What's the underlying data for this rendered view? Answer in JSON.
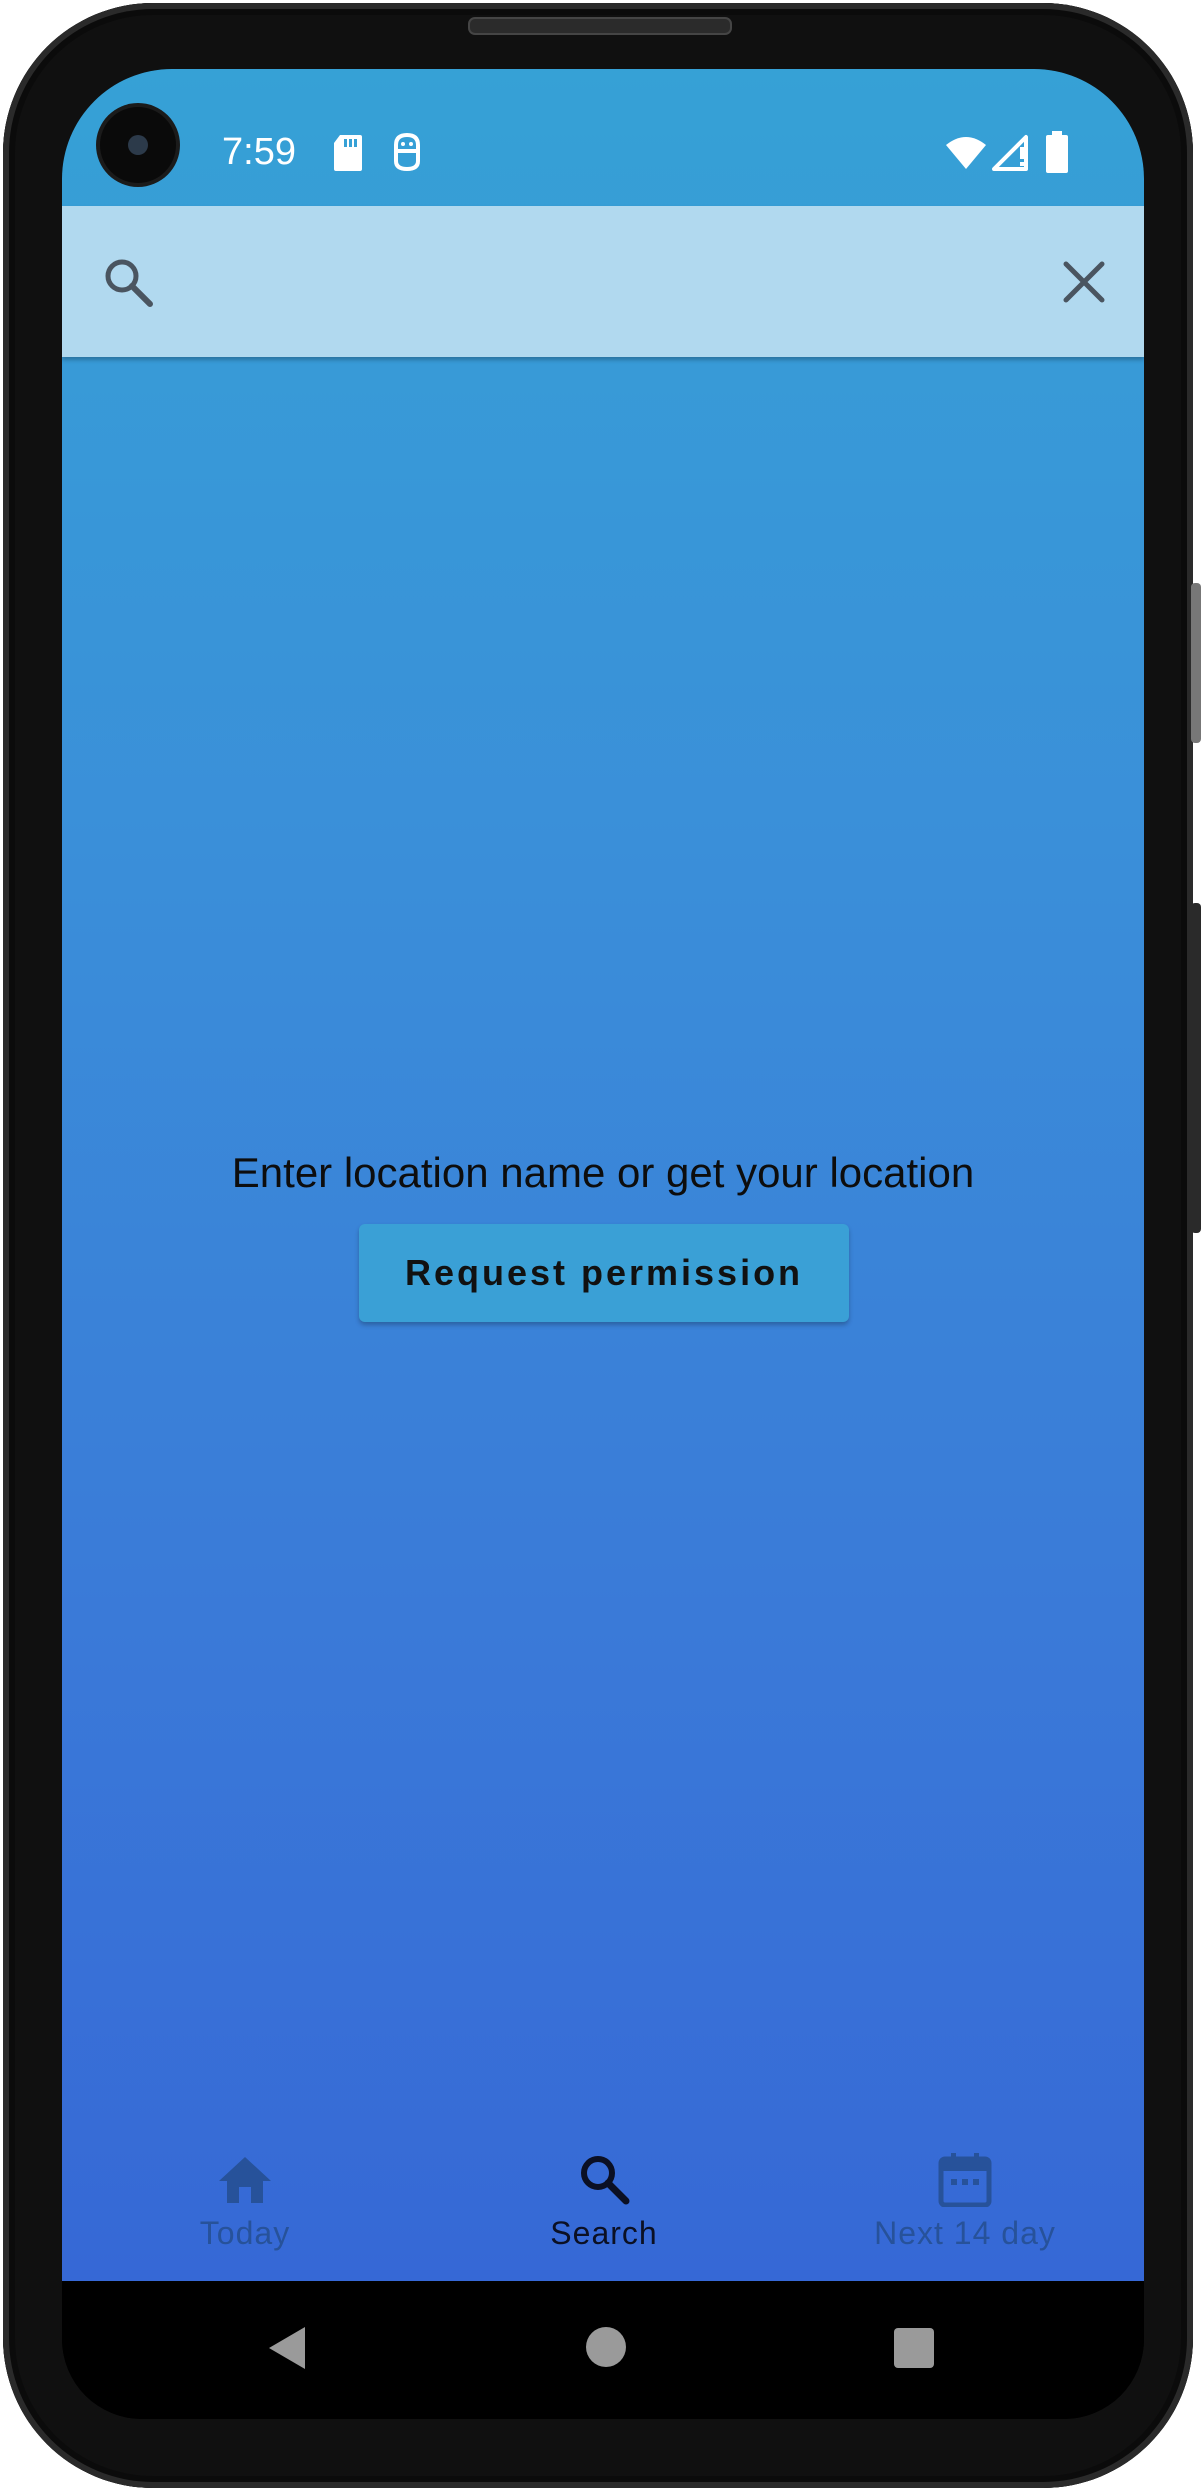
{
  "status_bar": {
    "time": "7:59",
    "icons": [
      "sd-card-icon",
      "debug-icon",
      "wifi-icon",
      "signal-icon",
      "battery-icon"
    ]
  },
  "search": {
    "value": "",
    "placeholder": "",
    "icons": [
      "search-icon",
      "close-icon"
    ]
  },
  "main": {
    "prompt": "Enter location name or get your location",
    "permission_button": "Request permission"
  },
  "bottom_nav": {
    "items": [
      {
        "label": "Today",
        "icon": "home-icon",
        "active": false
      },
      {
        "label": "Search",
        "icon": "search-icon",
        "active": true
      },
      {
        "label": "Next 14 day",
        "icon": "calendar-icon",
        "active": false
      }
    ]
  },
  "system_nav": {
    "icons": [
      "back-icon",
      "home-circle-icon",
      "recents-icon"
    ]
  },
  "colors": {
    "search_bar": "#b1d9ef",
    "gradient_top": "#36a1d6",
    "gradient_bottom": "#3668d6",
    "button": "#3aa0d6",
    "nav_inactive": "#27529a",
    "nav_active": "#0b1024"
  }
}
